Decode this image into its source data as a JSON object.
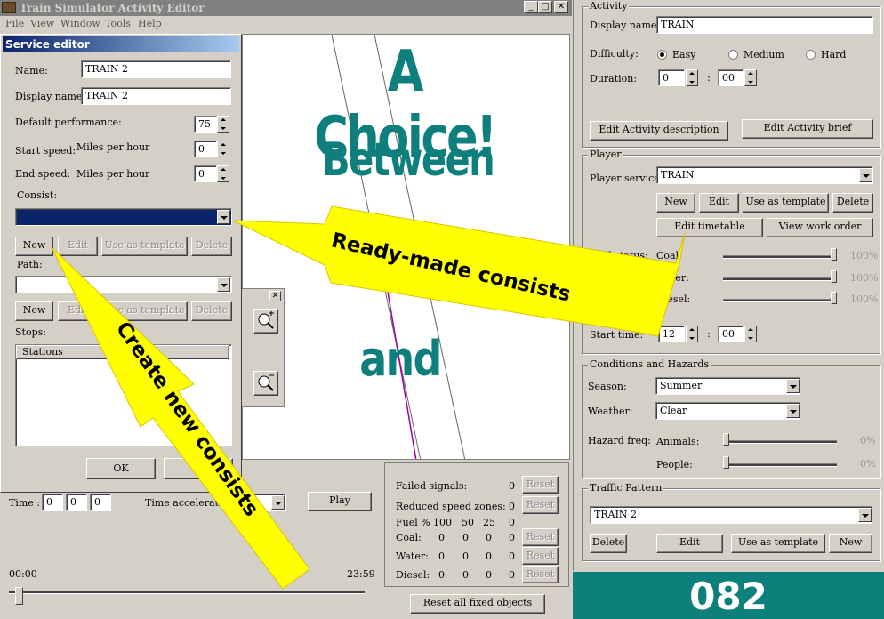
{
  "app": {
    "title": "Train Simulator Activity Editor",
    "menu": [
      "File",
      "View",
      "Window",
      "Tools",
      "Help"
    ]
  },
  "overlay_text": {
    "headline1": "A Choice!",
    "headline2": "Between",
    "headline3": "and",
    "arrow_ready": "Ready-made consists",
    "arrow_create": "Create new consists",
    "page_number": "082"
  },
  "service_editor": {
    "title": "Service editor",
    "name_label": "Name:",
    "name_value": "TRAIN 2",
    "display_name_label": "Display name:",
    "display_name_value": "TRAIN 2",
    "default_perf_label": "Default performance:",
    "default_perf_value": "75",
    "start_speed_label": "Start speed:",
    "end_speed_label": "End speed:",
    "speed_unit": "Miles per hour",
    "start_speed_value": "0",
    "end_speed_value": "0",
    "consist_label": "Consist:",
    "path_label": "Path:",
    "stops_label": "Stops:",
    "stations_header": "Stations",
    "btn_new": "New",
    "btn_edit": "Edit",
    "btn_template": "Use as template",
    "btn_delete": "Delete",
    "btn_ok": "OK",
    "btn_cancel": "Ca"
  },
  "bottom": {
    "time_label": "Time :",
    "time_fields": [
      "0",
      "0",
      "0"
    ],
    "time_accel_label": "Time acceleration",
    "play_label": "Play",
    "timeline_start": "00:00",
    "timeline_end": "23:59",
    "failed_signals_label": "Failed signals:",
    "failed_signals_value": "0",
    "reduced_speed_label": "Reduced speed zones:",
    "reduced_speed_value": "0",
    "reset_label": "Reset",
    "fuel_header": [
      "Fuel %",
      "100",
      "50",
      "25",
      "0"
    ],
    "fuel_rows": [
      {
        "label": "Coal:",
        "values": [
          "0",
          "0",
          "0",
          "0"
        ]
      },
      {
        "label": "Water:",
        "values": [
          "0",
          "0",
          "0",
          "0"
        ]
      },
      {
        "label": "Diesel:",
        "values": [
          "0",
          "0",
          "0",
          "0"
        ]
      }
    ],
    "reset_all_label": "Reset all fixed objects"
  },
  "activity": {
    "group_title": "Activity",
    "display_name_label": "Display name:",
    "display_name_value": "TRAIN",
    "difficulty_label": "Difficulty:",
    "difficulty_options": [
      "Easy",
      "Medium",
      "Hard"
    ],
    "difficulty_selected": "Easy",
    "duration_label": "Duration:",
    "duration_hours": "0",
    "duration_minutes": "00",
    "time_sep": ":",
    "edit_description": "Edit Activity description",
    "edit_brief": "Edit Activity brief"
  },
  "player": {
    "group_title": "Player",
    "service_label": "Player service:",
    "service_value": "TRAIN",
    "btn_new": "New",
    "btn_edit": "Edit",
    "btn_template": "Use as template",
    "btn_delete": "Delete",
    "btn_timetable": "Edit timetable",
    "btn_work_order": "View work order",
    "fuel_status_label": "Fuel status:",
    "fuel": [
      {
        "label": "Coal:",
        "value": "100%",
        "level": 1.0
      },
      {
        "label": "Water:",
        "value": "100%",
        "level": 1.0
      },
      {
        "label": "Diesel:",
        "value": "100%",
        "level": 1.0
      }
    ],
    "start_time_label": "Start time:",
    "start_hours": "12",
    "start_minutes": "00"
  },
  "conditions": {
    "group_title": "Conditions and Hazards",
    "season_label": "Season:",
    "season_value": "Summer",
    "weather_label": "Weather:",
    "weather_value": "Clear",
    "hazard_label": "Hazard freq:",
    "animals_label": "Animals:",
    "animals_value": "0%",
    "people_label": "People:",
    "people_value": "0%"
  },
  "traffic": {
    "group_title": "Traffic Pattern",
    "value": "TRAIN 2",
    "btn_delete": "Delete",
    "btn_edit": "Edit",
    "btn_template": "Use as template",
    "btn_new": "New"
  },
  "colors": {
    "headline": "#0e7f7c",
    "arrow": "#ffff00",
    "page_band": "#0e807c",
    "title_active": "#0a246a",
    "title_inactive": "#808080"
  }
}
